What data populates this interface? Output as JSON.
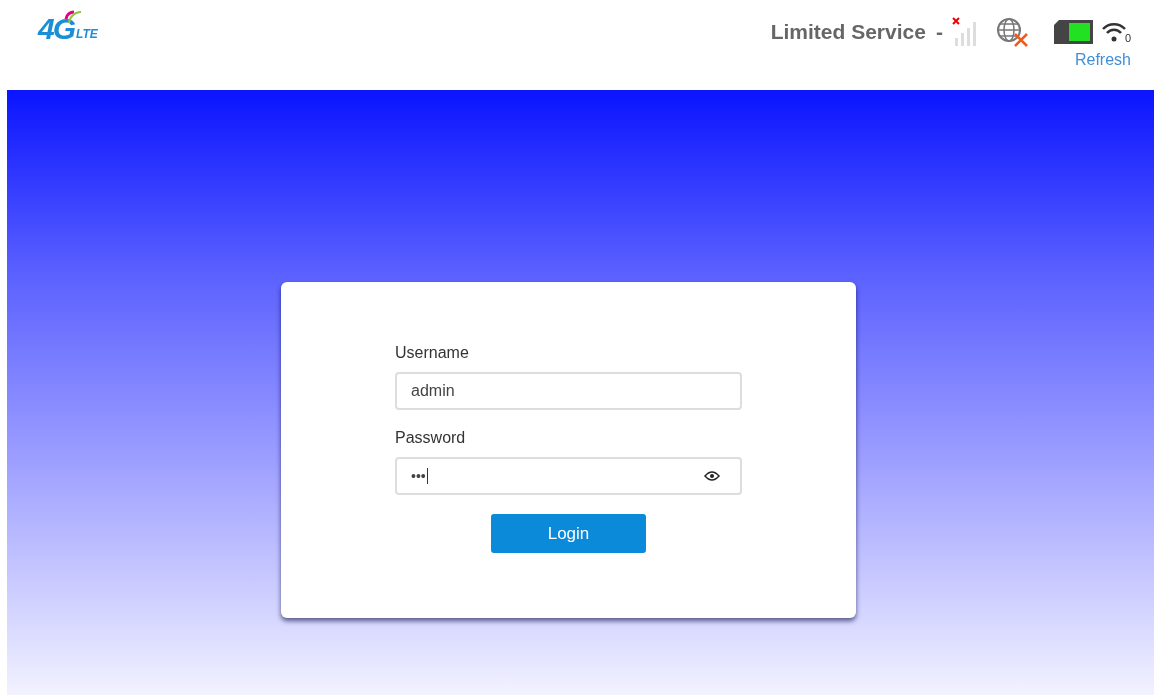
{
  "header": {
    "logo": {
      "main": "4G",
      "sub": "LTE"
    },
    "status_text": "Limited Service",
    "separator": "-",
    "wifi_clients": "0",
    "refresh_link": "Refresh"
  },
  "login": {
    "username_label": "Username",
    "username_value": "admin",
    "password_label": "Password",
    "password_value": "•••",
    "button": "Login"
  }
}
